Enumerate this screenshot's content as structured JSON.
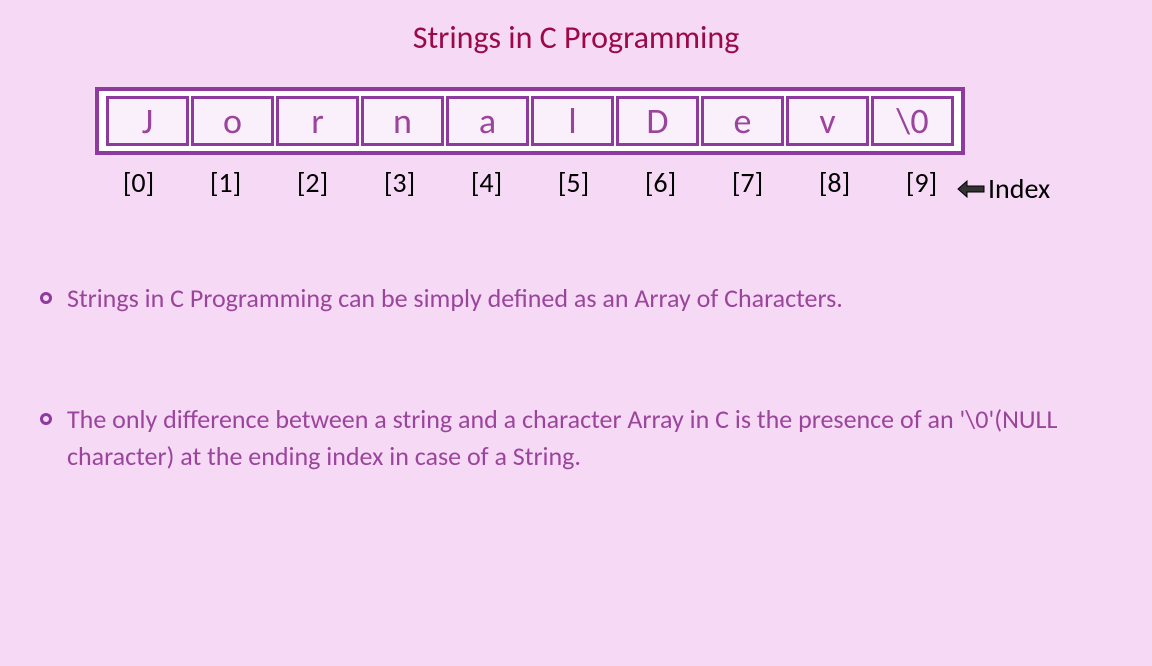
{
  "title": "Strings in C Programming",
  "cells": [
    "J",
    "o",
    "r",
    "n",
    "a",
    "l",
    "D",
    "e",
    "v",
    "\\0"
  ],
  "indices": [
    "[0]",
    "[1]",
    "[2]",
    "[3]",
    "[4]",
    "[5]",
    "[6]",
    "[7]",
    "[8]",
    "[9]"
  ],
  "index_label": "Index",
  "bullets": [
    "Strings in C Programming can be simply defined as an Array of Characters.",
    "The only difference between a string and a character Array in C is the presence of an '\\0'(NULL character) at the ending index in case of a String."
  ]
}
